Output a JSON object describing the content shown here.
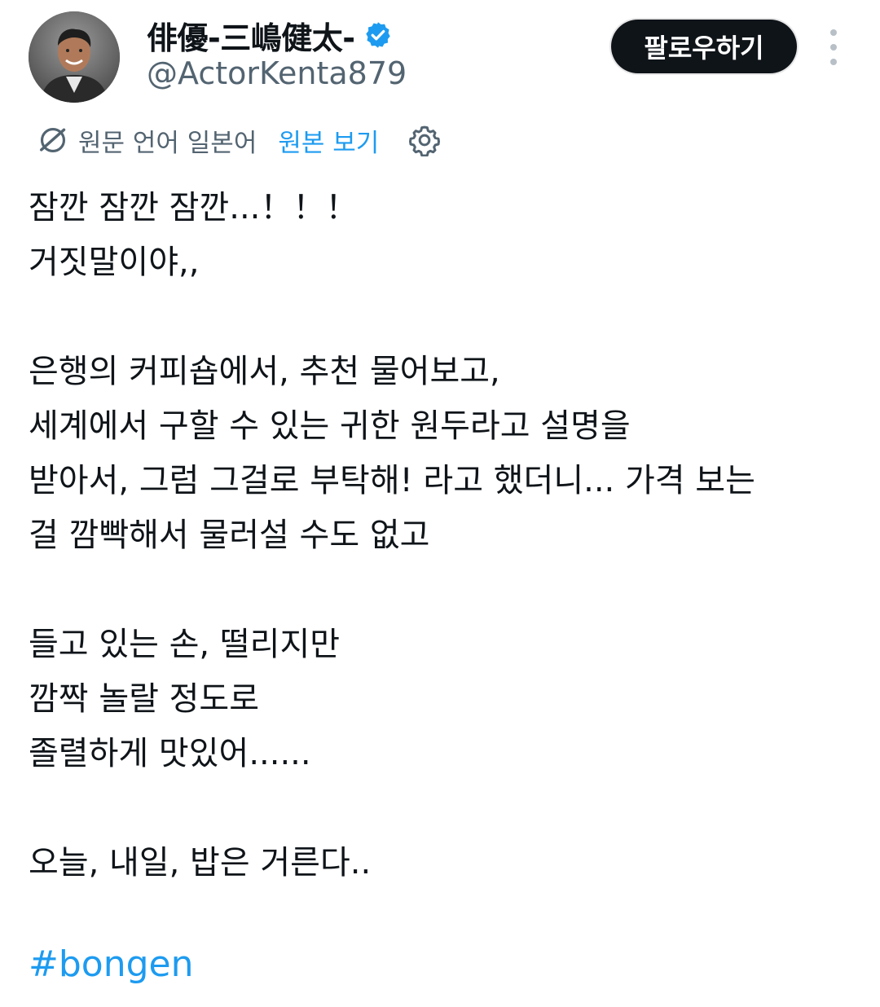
{
  "profile": {
    "display_name": "俳優-三嶋健太-",
    "handle": "@ActorKenta879",
    "verified_icon": "verified-badge-icon",
    "avatar": "avatar"
  },
  "actions": {
    "follow_label": "팔로우하기",
    "more_icon": "more-vertical-icon"
  },
  "translation": {
    "note": "원문 언어 일본어",
    "view_original_label": "원본 보기",
    "translate_icon": "translate-icon",
    "settings_icon": "gear-icon"
  },
  "tweet": {
    "lines": [
      "잠깐 잠깐 잠깐...！！！",
      "거짓말이야,,",
      "",
      "은행의 커피숍에서, 추천 물어보고,",
      "세계에서 구할 수 있는 귀한 원두라고 설명을",
      "받아서, 그럼 그걸로 부탁해! 라고 했더니... 가격 보는",
      "걸 깜빡해서 물러설 수도 없고",
      "",
      "들고 있는 손, 떨리지만",
      "깜짝 놀랄 정도로",
      "졸렬하게 맛있어......",
      "",
      "오늘, 내일, 밥은 거른다.."
    ],
    "hashtag": "#bongen"
  },
  "colors": {
    "link": "#1d9bf0",
    "text": "#0f1419",
    "secondary": "#536471",
    "button_bg": "#0f1419"
  }
}
